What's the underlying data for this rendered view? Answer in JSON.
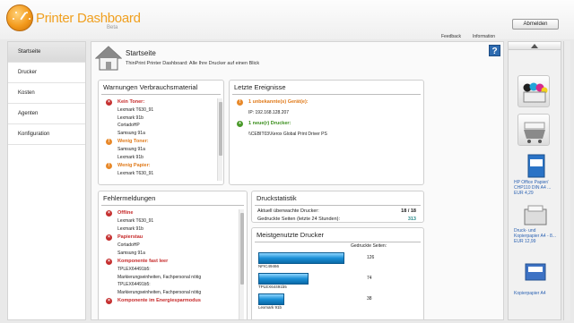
{
  "header": {
    "app_title": "Printer Dashboard",
    "app_subtitle": "Beta",
    "logout_label": "Abmelden",
    "links": [
      "Feedback",
      "Information"
    ]
  },
  "sidebar": {
    "items": [
      {
        "label": "Startseite",
        "active": true
      },
      {
        "label": "Drucker",
        "active": false
      },
      {
        "label": "Kosten",
        "active": false
      },
      {
        "label": "Agenten",
        "active": false
      },
      {
        "label": "Konfiguration",
        "active": false
      }
    ]
  },
  "page": {
    "title": "Startseite",
    "description": "ThinPrint Printer Dashboard: Alle Ihre Drucker auf einen Blick",
    "help_label": "?"
  },
  "warnings": {
    "title": "Warnungen Verbrauchsmaterial",
    "groups": [
      {
        "label": "Kein Toner:",
        "color": "red",
        "items": [
          "Lexmark T630_91",
          "Lexmark 91b",
          "CortadoHP",
          "Samsung 91a"
        ]
      },
      {
        "label": "Wenig Toner:",
        "color": "orange",
        "items": [
          "Samsung 91a",
          "Lexmark 91b"
        ]
      },
      {
        "label": "Wenig Papier:",
        "color": "orange",
        "items": [
          "Lexmark T630_91"
        ]
      }
    ]
  },
  "events": {
    "title": "Letzte Ereignisse",
    "unknown_label": "1 unbekannte(s) Gerät(e):",
    "unknown_ip": "IP: 192.168.128.207",
    "new_label": "1 neue(r) Drucker:",
    "new_printer": "\\\\CEBIT03\\Xerox Global Print Driver PS"
  },
  "errors": {
    "title": "Fehlermeldungen",
    "groups": [
      {
        "label": "Offline",
        "items": [
          "Lexmark T630_91",
          "Lexmark 91b"
        ]
      },
      {
        "label": "Papierstau",
        "items": [
          "CortadoHP",
          "Samsung 91a"
        ]
      },
      {
        "label": "Komponente fast leer",
        "items": [
          "TPLEX64491b5:",
          "Markierungseinheiten, Fachpersonal nötig",
          "TPLEX64491b5:",
          "Markierungseinheiten, Fachpersonal nötig"
        ]
      },
      {
        "label": "Komponente im Energiesparmodus",
        "items": []
      }
    ]
  },
  "stats": {
    "title": "Druckstatistik",
    "monitored_label": "Aktuell überwachte Drucker:",
    "monitored_value": "18 / 18",
    "pages_label": "Gedruckte Seiten (letzte 24 Stunden):",
    "pages_value": "313",
    "pages_color": "#2a8a8a"
  },
  "top_printers": {
    "title": "Meistgenutzte Drucker",
    "value_header": "Gedruckte Seiten:",
    "printers": [
      {
        "name": "NFIC49466",
        "pages": 126
      },
      {
        "name": "TPLEX64491b5",
        "pages": 74
      },
      {
        "name": "Lexmark 91b",
        "pages": 38
      }
    ]
  },
  "ads": [
    {
      "icon": "ink-cartridges-icon",
      "link": "",
      "price": ""
    },
    {
      "icon": "shopping-cart-icon",
      "link": "",
      "price": ""
    },
    {
      "icon": "paper-box-icon",
      "link": "HP Office Papier/ CHP110 DIN A4 ...",
      "price": "EUR 4,29"
    },
    {
      "icon": "printer-product-icon",
      "link": "Druck- und Kopierpapier A4 - 8...",
      "price": "EUR 12,99"
    },
    {
      "icon": "paper-stack-icon",
      "link": "Kopierpapier A4",
      "price": ""
    }
  ],
  "colors": {
    "accent": "#f0a020",
    "error_red": "#c62a2a",
    "warning_orange": "#e07a1a",
    "ok_green": "#3b8f1d",
    "bar_blue": "#1a8fd6"
  }
}
